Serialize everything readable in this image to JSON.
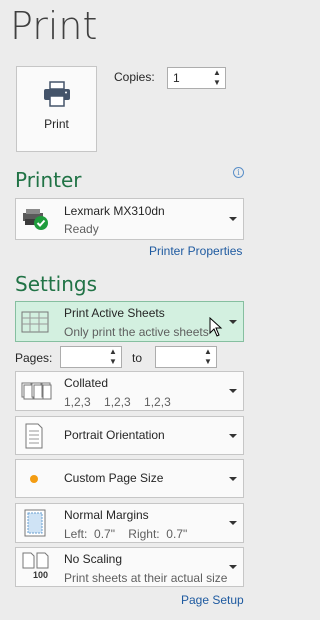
{
  "title": "Print",
  "print_button": {
    "label": "Print"
  },
  "copies": {
    "label": "Copies:",
    "value": "1"
  },
  "printer": {
    "heading": "Printer",
    "name": "Lexmark MX310dn",
    "status": "Ready",
    "properties_link": "Printer Properties"
  },
  "settings": {
    "heading": "Settings",
    "sheets": {
      "title": "Print Active Sheets",
      "subtitle": "Only print the active sheets"
    },
    "pages": {
      "label": "Pages:",
      "to_label": "to",
      "from_value": "",
      "to_value": ""
    },
    "collation": {
      "title": "Collated",
      "subtitle": "1,2,3    1,2,3    1,2,3"
    },
    "orientation": {
      "title": "Portrait Orientation"
    },
    "page_size": {
      "title": "Custom Page Size"
    },
    "margins": {
      "title": "Normal Margins",
      "subtitle": "Left:  0.7\"    Right:  0.7\""
    },
    "scaling": {
      "title": "No Scaling",
      "subtitle": "Print sheets at their actual size",
      "icon_text": "100"
    },
    "page_setup_link": "Page Setup"
  },
  "colors": {
    "accent_green": "#217346",
    "link_blue": "#1e5aa0",
    "active_bg": "#d3f0e0"
  }
}
